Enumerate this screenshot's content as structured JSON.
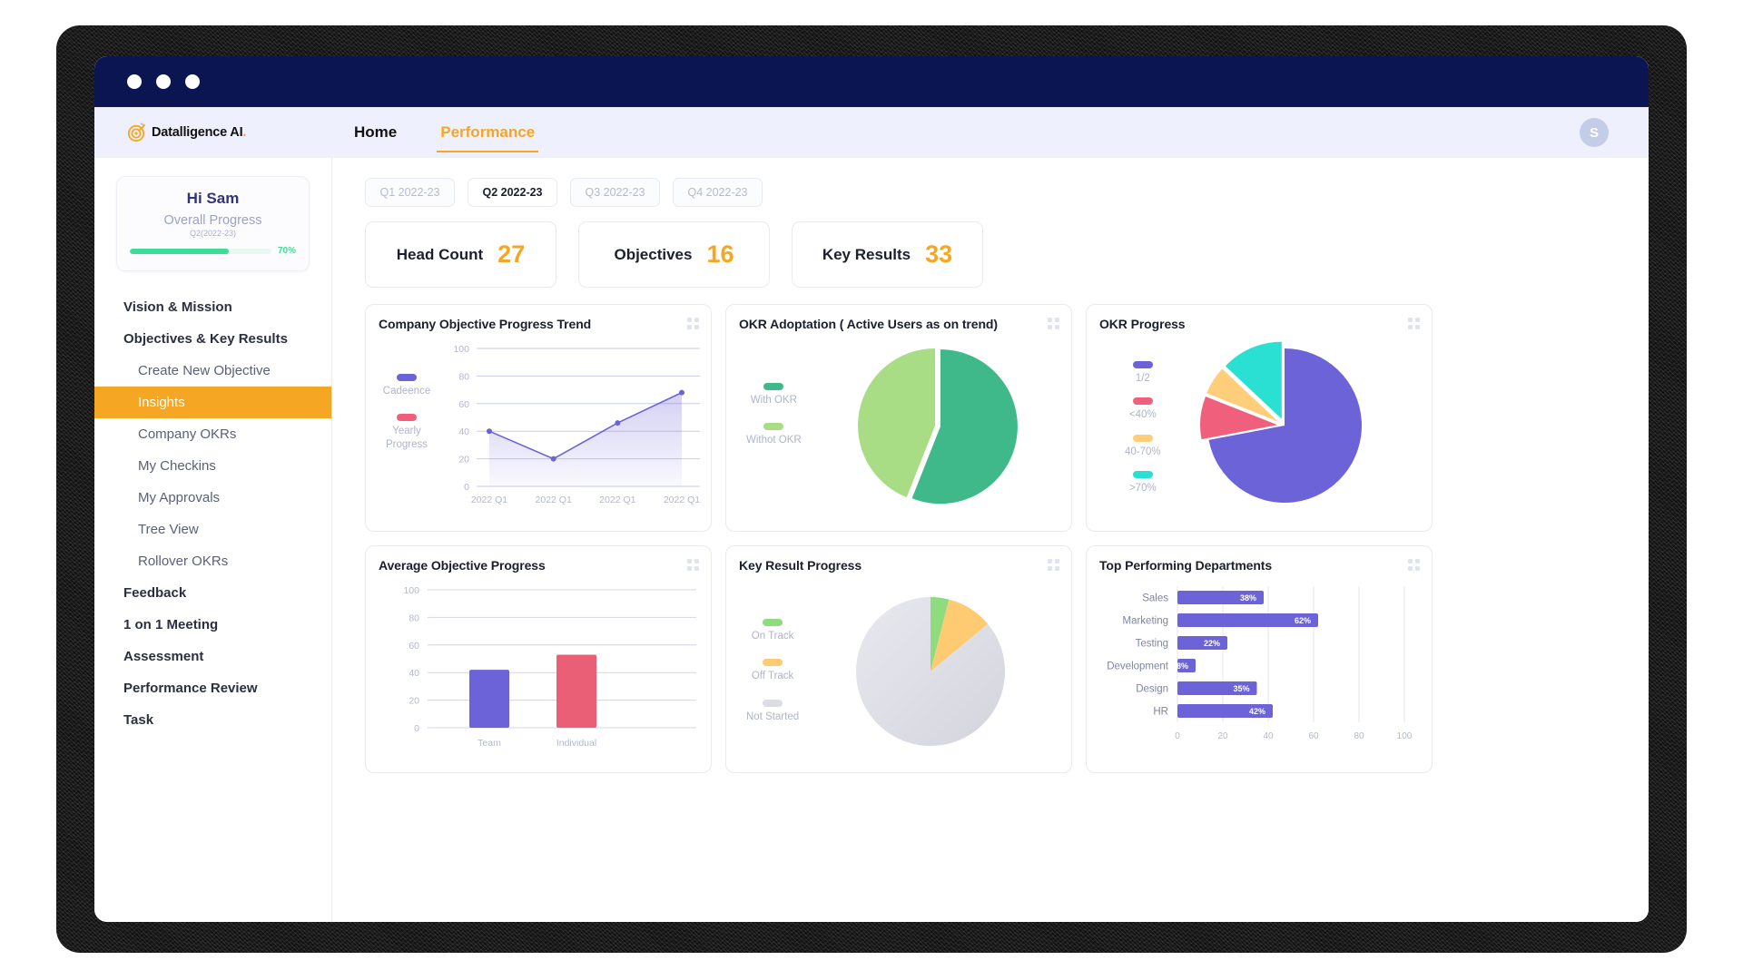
{
  "window": {
    "traffic_lights": [
      "close",
      "minimize",
      "maximize"
    ]
  },
  "header": {
    "brand_name": "Datalligence AI",
    "brand_dot": ".",
    "nav": [
      {
        "label": "Home",
        "active": false
      },
      {
        "label": "Performance",
        "active": true
      }
    ],
    "avatar_initial": "S"
  },
  "sidebar": {
    "user_card": {
      "greeting": "Hi Sam",
      "progress_label": "Overall Progress",
      "period": "Q2(2022-23)",
      "progress_percent": "70%",
      "progress_value": 70,
      "progress_color": "#3ddc97"
    },
    "items": [
      {
        "label": "Vision & Mission",
        "level": "top",
        "active": false
      },
      {
        "label": "Objectives & Key Results",
        "level": "top",
        "active": false
      },
      {
        "label": "Create New Objective",
        "level": "sub",
        "active": false
      },
      {
        "label": "Insights",
        "level": "sub",
        "active": true
      },
      {
        "label": "Company OKRs",
        "level": "sub",
        "active": false
      },
      {
        "label": "My  Checkins",
        "level": "sub",
        "active": false
      },
      {
        "label": "My Approvals",
        "level": "sub",
        "active": false
      },
      {
        "label": "Tree View",
        "level": "sub",
        "active": false
      },
      {
        "label": "Rollover OKRs",
        "level": "sub",
        "active": false
      },
      {
        "label": "Feedback",
        "level": "top",
        "active": false
      },
      {
        "label": "1 on 1 Meeting",
        "level": "top",
        "active": false
      },
      {
        "label": "Assessment",
        "level": "top",
        "active": false
      },
      {
        "label": "Performance Review",
        "level": "top",
        "active": false
      },
      {
        "label": "Task",
        "level": "top",
        "active": false
      }
    ],
    "active_color": "#f5a623"
  },
  "main": {
    "quarter_tabs": [
      {
        "label": "Q1 2022-23",
        "active": false
      },
      {
        "label": "Q2 2022-23",
        "active": true
      },
      {
        "label": "Q3 2022-23",
        "active": false
      },
      {
        "label": "Q4 2022-23",
        "active": false
      }
    ],
    "stats": [
      {
        "label": "Head Count",
        "value": "27"
      },
      {
        "label": "Objectives",
        "value": "16"
      },
      {
        "label": "Key Results",
        "value": "33"
      }
    ]
  },
  "chart_data": [
    {
      "id": "company-objective-progress-trend",
      "type": "area",
      "title": "Company Objective Progress Trend",
      "categories": [
        "2022 Q1",
        "2022 Q1",
        "2022 Q1",
        "2022 Q1"
      ],
      "series": [
        {
          "name": "Cadeence",
          "color": "#6c63d8",
          "values": [
            40,
            20,
            46,
            68
          ]
        },
        {
          "name": "Yearly Progress",
          "color": "#f0607d",
          "values": []
        }
      ],
      "legend": [
        {
          "label": "Cadeence",
          "color": "#6c63d8"
        },
        {
          "label": "Yearly Progress",
          "color": "#f0607d"
        }
      ],
      "ylabel": "",
      "xlabel": "",
      "yticks": [
        "100",
        "80",
        "60",
        "40",
        "20",
        "0"
      ],
      "ylim": [
        0,
        100
      ],
      "grid": true,
      "legend_position": "left"
    },
    {
      "id": "okr-adoptation",
      "type": "pie",
      "title": "OKR Adoptation ( Active Users as on trend)",
      "labels": [
        "With OKR",
        "Withot OKR"
      ],
      "values": [
        56,
        44
      ],
      "colors": [
        "#3fb98a",
        "#a9dd85"
      ],
      "legend_position": "left"
    },
    {
      "id": "okr-progress",
      "type": "pie",
      "title": "OKR Progress",
      "labels": [
        "1/2",
        "<40%",
        "40-70%",
        ">70%"
      ],
      "values": [
        72,
        9,
        6,
        13
      ],
      "colors": [
        "#6c63d8",
        "#f0607d",
        "#ffce7a",
        "#29e0d2"
      ],
      "legend_position": "left"
    },
    {
      "id": "average-objective-progress",
      "type": "bar",
      "title": "Average Objective Progress",
      "categories": [
        "Team",
        "Individual"
      ],
      "values": [
        42,
        53
      ],
      "colors": [
        "#6c63d8",
        "#ea5f75"
      ],
      "yticks": [
        "100",
        "80",
        "60",
        "40",
        "20",
        "0"
      ],
      "ylim": [
        0,
        100
      ],
      "grid": true
    },
    {
      "id": "key-result-progress",
      "type": "pie",
      "title": "Key Result Progress",
      "labels": [
        "On Track",
        "Off Track",
        "Not Started"
      ],
      "values": [
        4,
        10,
        86
      ],
      "colors": [
        "#8fdc7e",
        "#ffcb72",
        "#dcdde3"
      ],
      "legend_position": "left"
    },
    {
      "id": "top-performing-departments",
      "type": "bar",
      "orientation": "horizontal",
      "title": "Top Performing Departments",
      "categories": [
        "Sales",
        "Marketing",
        "Testing",
        "Development",
        "Design",
        "HR"
      ],
      "values": [
        38,
        62,
        22,
        8,
        35,
        42
      ],
      "value_labels": [
        "38%",
        "62%",
        "22%",
        "8%",
        "35%",
        "42%"
      ],
      "bar_color": "#6c63d8",
      "xticks": [
        "0",
        "20",
        "40",
        "60",
        "80",
        "100"
      ],
      "xlim": [
        0,
        100
      ],
      "grid": true
    }
  ]
}
